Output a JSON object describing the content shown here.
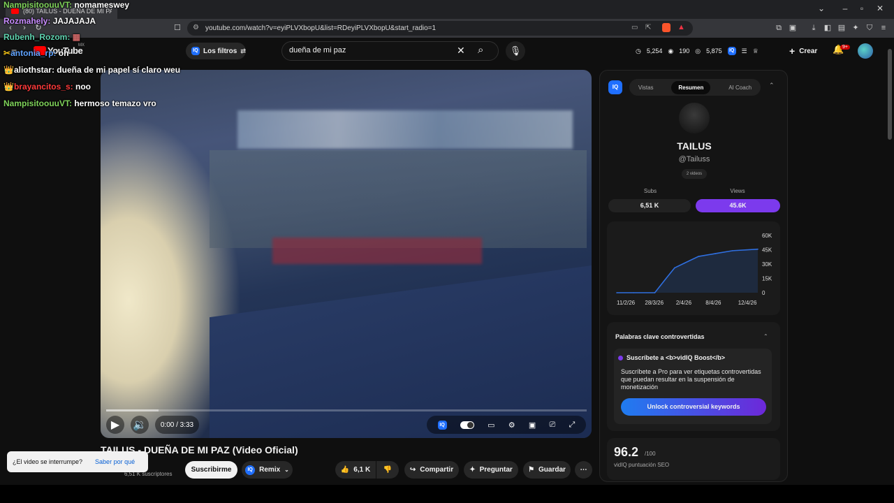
{
  "browser": {
    "tab_title": "(80) TAILUS - DUEÑA DE MI PA",
    "url": "youtube.com/watch?v=eyiPLVXbopU&list=RDeyiPLVXbopU&start_radio=1"
  },
  "youtube_header": {
    "logo_text": "YouTube",
    "region": "MX",
    "filters_label": "Los filtros",
    "search_value": "dueña de mi paz",
    "stats": [
      "5,254",
      "190",
      "5,875"
    ],
    "create_label": "Crear",
    "notif_count": "9+"
  },
  "video": {
    "time": "0:00 / 3:33",
    "progress_fraction": 0.0,
    "title": "TAILUS - DUEÑA DE MI PAZ (Video Oficial)",
    "subscribers": "6,51 K suscriptores",
    "subscribe_label": "Suscribirme",
    "remix_label": "Remix",
    "likes": "6,1 K",
    "share_label": "Compartir",
    "ask_label": "Preguntar",
    "save_label": "Guardar"
  },
  "toast": {
    "text": "¿El video se interrumpe?",
    "link": "Saber por qué"
  },
  "panel": {
    "iq_badge": "IQ",
    "tabs": [
      "Vistas",
      "Resumen",
      "AI Coach"
    ],
    "active_tab": "Resumen",
    "channel_name": "TAILUS",
    "channel_handle": "@Tailuss",
    "video_count": "2 videos",
    "subs_label": "Subs",
    "views_label": "Views",
    "subs_value": "6,51 K",
    "views_value": "45.6K",
    "keywords_title": "Palabras clave controvertidas",
    "keywords_subtitle": "Suscríbete a <b>vidIQ Boost</b>",
    "keywords_desc": "Suscríbete a Pro para ver etiquetas controvertidas que puedan resultar en la suspensión de monetización",
    "unlock_label": "Unlock controversial keywords",
    "seo_score": "96.2",
    "seo_max": "/100",
    "seo_label": "vidIQ puntuación SEO"
  },
  "chart_data": {
    "type": "area",
    "x": [
      "11/2/26",
      "28/3/26",
      "2/4/26",
      "8/4/26",
      "12/4/26"
    ],
    "series": [
      {
        "values": [
          {
            "x": "start",
            "y": 0
          },
          {
            "x": "11/2/26",
            "y": 0
          },
          {
            "x": "23/3/26",
            "y": 0
          },
          {
            "x": "26/3/26",
            "y": 15000
          },
          {
            "x": "28/3/26",
            "y": 26000
          },
          {
            "x": "30/3/26",
            "y": 31000
          },
          {
            "x": "2/4/26",
            "y": 38000
          },
          {
            "x": "5/4/26",
            "y": 41000
          },
          {
            "x": "8/4/26",
            "y": 44000
          },
          {
            "x": "12/4/26",
            "y": 45600
          }
        ]
      }
    ],
    "yticks": [
      "60K",
      "45K",
      "30K",
      "15K",
      "0"
    ],
    "ylim": [
      0,
      60000
    ],
    "title": "",
    "xlabel": "",
    "ylabel": "",
    "color": "#2f6fe0"
  },
  "chat": [
    {
      "user": "NampisitoouuVT:",
      "msg": "nomameswey",
      "color": "#7fd35a",
      "badge": ""
    },
    {
      "user": "Rozmahely:",
      "msg": "JAJAJAJA",
      "color": "#c98cff",
      "badge": ""
    },
    {
      "user": "Rubenh_Rozom:",
      "msg": "",
      "color": "#5fd3b0",
      "badge": ""
    },
    {
      "user": "antonia_rp:",
      "msg": "oh",
      "color": "#5fa3ff",
      "badge": "✂"
    },
    {
      "user": "aliothstar:",
      "msg": "dueña de mi papel sí claro weu",
      "color": "#ffffff",
      "badge": "👑"
    },
    {
      "user": "brayancitos_s:",
      "msg": "noo",
      "color": "#ff3a3a",
      "badge": "👑"
    },
    {
      "user": "NampisitoouuVT:",
      "msg": "hermoso temazo vro",
      "color": "#7fd35a",
      "badge": ""
    }
  ]
}
